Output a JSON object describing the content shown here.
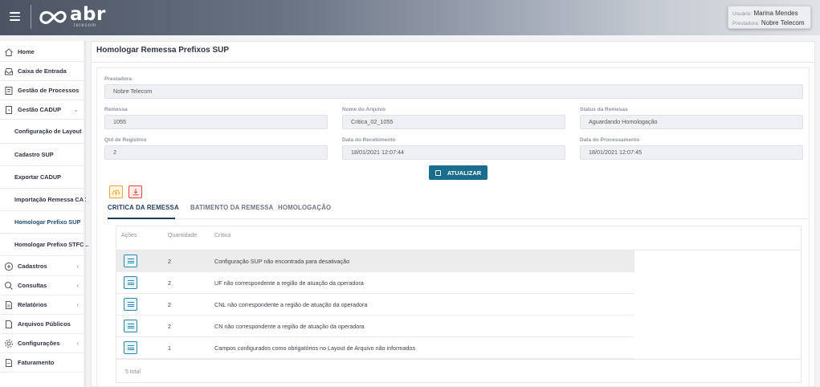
{
  "header": {
    "logo_text": "abr",
    "logo_sub": "telecom",
    "user_label": "Usuário:",
    "user_value": "Marina Mendes",
    "provider_label": "Prestadora:",
    "provider_value": "Nobre Telecom"
  },
  "sidebar": {
    "items": [
      {
        "label": "Home",
        "icon": "home-icon"
      },
      {
        "label": "Caixa de Entrada",
        "icon": "inbox-icon"
      },
      {
        "label": "Gestão de Processos",
        "icon": "process-icon"
      },
      {
        "label": "Gestão CADUP",
        "icon": "document-icon"
      },
      {
        "label": "Configuração de Layout"
      },
      {
        "label": "Cadastro SUP"
      },
      {
        "label": "Exportar CADUP"
      },
      {
        "label": "Importação Remessa CADUP"
      },
      {
        "label": "Homologar Prefixo SUP"
      },
      {
        "label": "Homologar Prefixo STFC..."
      },
      {
        "label": "Cadastros",
        "icon": "plus-circle-icon"
      },
      {
        "label": "Consultas",
        "icon": "search-icon"
      },
      {
        "label": "Relatórios",
        "icon": "report-icon"
      },
      {
        "label": "Arquivos Públicos",
        "icon": "file-icon"
      },
      {
        "label": "Configurações",
        "icon": "gear-icon"
      },
      {
        "label": "Faturamento",
        "icon": "billing-icon"
      }
    ]
  },
  "page": {
    "title": "Homologar Remessa Prefixos SUP"
  },
  "form": {
    "prestadora_label": "Prestadora",
    "prestadora_value": "Nobre Telecom",
    "remessa_label": "Remessa",
    "remessa_value": "1055",
    "arquivo_label": "Nome do Arquivo",
    "arquivo_value": "Critica_02_1055",
    "status_label": "Status da Remesas",
    "status_value": "Aguardando Homologação",
    "qtd_label": "Qtd de Registros",
    "qtd_value": "2",
    "recebimento_label": "Data do Recebimento",
    "recebimento_value": "18/01/2021 12:07:44",
    "processamento_label": "Data do Processamento",
    "processamento_value": "18/01/2021 12:07:45",
    "atualizar_label": "ATUALIZAR"
  },
  "tabs": [
    {
      "label": "CRITICA DA REMESSA"
    },
    {
      "label": "BATIMENTO DA REMESSA"
    },
    {
      "label": "HOMOLOGAÇÃO"
    }
  ],
  "table": {
    "headers": [
      "Ações",
      "Quantidade",
      "Crítica"
    ],
    "rows": [
      {
        "quantidade": "2",
        "critica": "Configuração SUP não encontrada para desativação"
      },
      {
        "quantidade": "2",
        "critica": "UF não correspondente a região de atuação da operadora"
      },
      {
        "quantidade": "2",
        "critica": "CNL não correspondente a região de atuação da operadora"
      },
      {
        "quantidade": "2",
        "critica": "CN não correspondente a região de atuação da operadora"
      },
      {
        "quantidade": "1",
        "critica": "Campos configurados como obrigatórios no Layout de Arquivo não informados"
      }
    ],
    "total": "5 total"
  }
}
